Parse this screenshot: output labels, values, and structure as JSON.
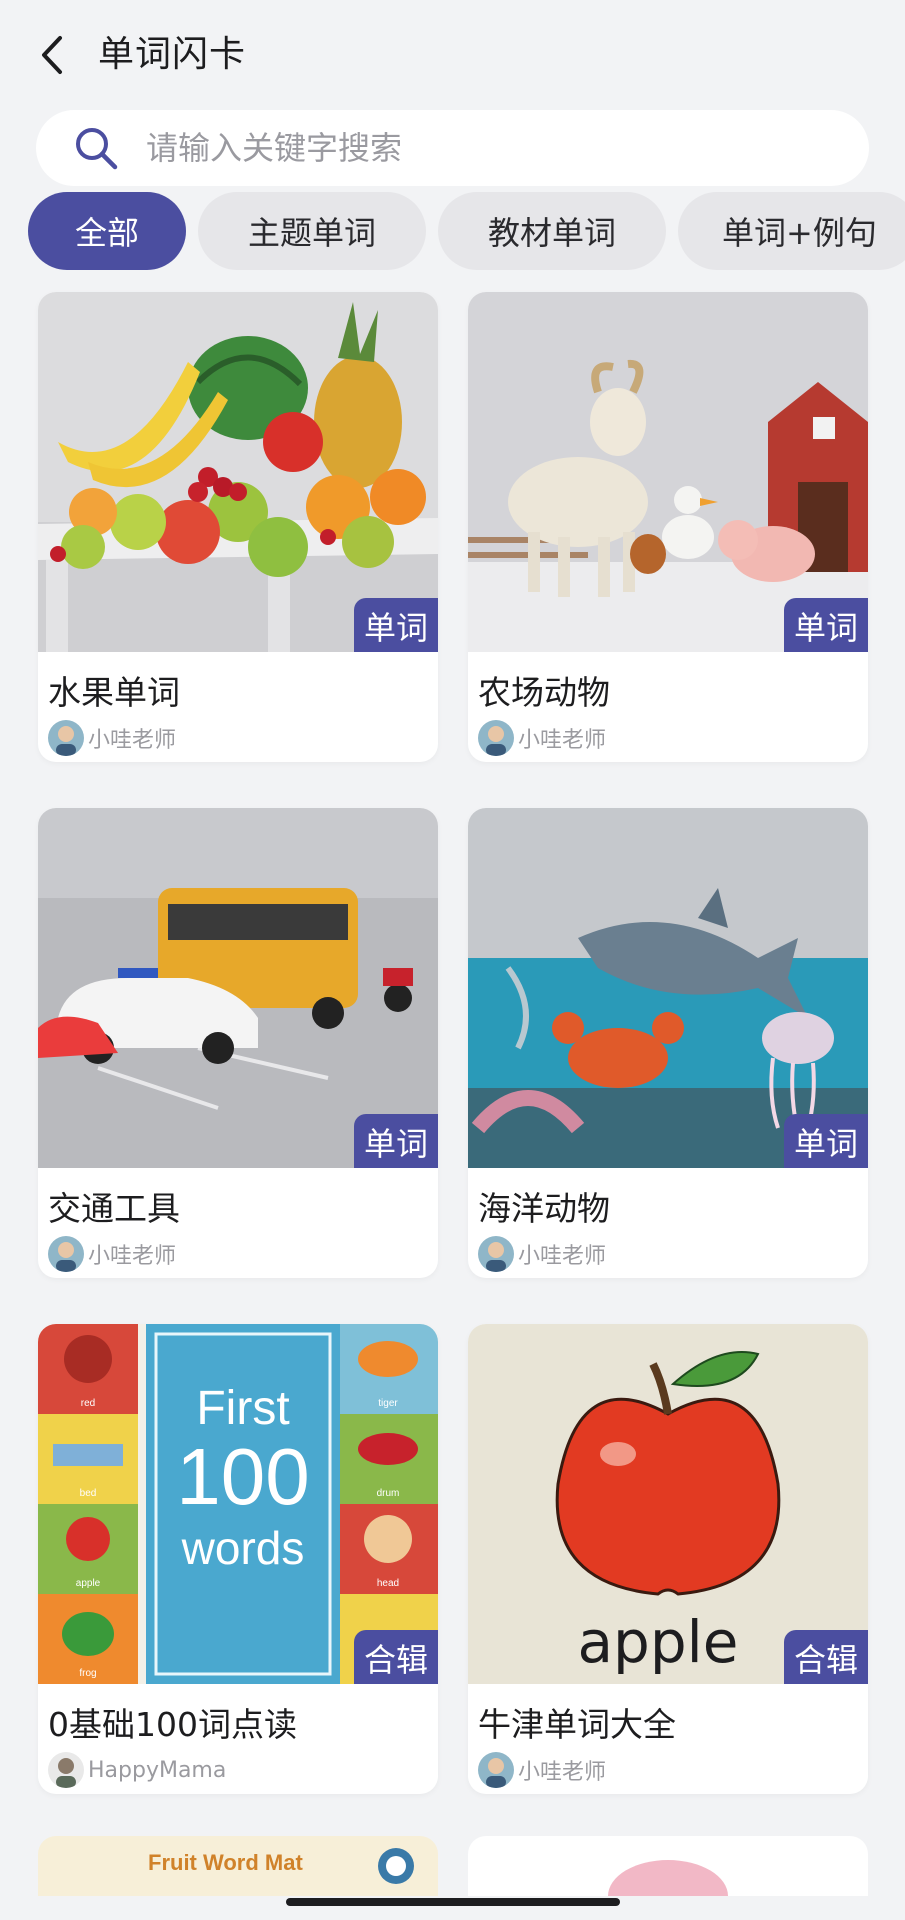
{
  "header": {
    "title": "单词闪卡"
  },
  "search": {
    "placeholder": "请输入关键字搜索"
  },
  "tabs": [
    "全部",
    "主题单词",
    "教材单词",
    "单词+例句"
  ],
  "cards": [
    {
      "title": "水果单词",
      "badge": "单词",
      "author": "小哇老师",
      "image": "fruit-table"
    },
    {
      "title": "农场动物",
      "badge": "单词",
      "author": "小哇老师",
      "image": "farm-animals"
    },
    {
      "title": "交通工具",
      "badge": "单词",
      "author": "小哇老师",
      "image": "vehicles"
    },
    {
      "title": "海洋动物",
      "badge": "单词",
      "author": "小哇老师",
      "image": "ocean-animals"
    },
    {
      "title": "0基础100词点读",
      "badge": "合辑",
      "author": "HappyMama",
      "image": "first-100-words"
    },
    {
      "title": "牛津单词大全",
      "badge": "合辑",
      "author": "小哇老师",
      "image": "apple"
    }
  ],
  "images": {
    "first100": {
      "line1": "First",
      "line2": "100",
      "line3": "words"
    },
    "first100_tiles": [
      "red",
      "bed",
      "apple",
      "frog",
      "tiger",
      "drum",
      "head"
    ],
    "apple_word": "apple",
    "fruit_mat": "Fruit Word Mat"
  },
  "colors": {
    "accent": "#4b4ea0",
    "tab_inactive": "#e6e6e9",
    "background": "#f2f3f5"
  }
}
